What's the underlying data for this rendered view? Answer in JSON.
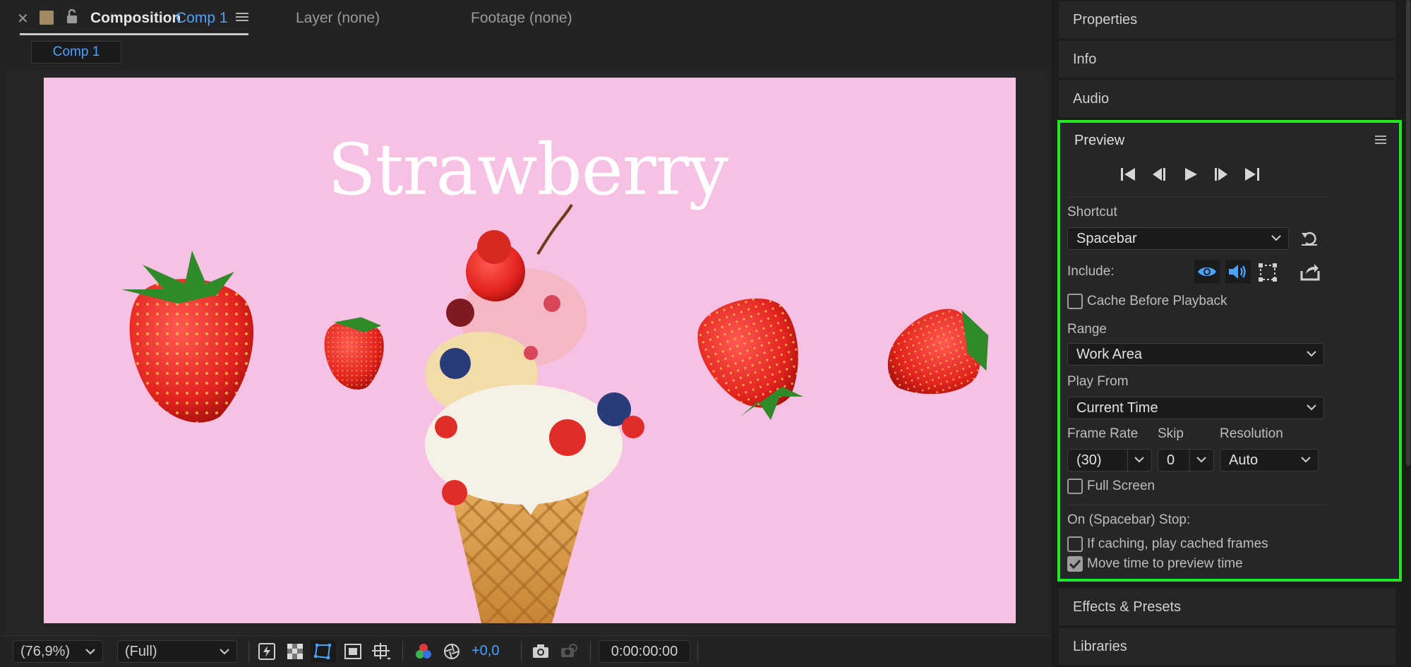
{
  "tabs": {
    "composition_label": "Composition",
    "composition_name": "Comp 1",
    "layer": "Layer (none)",
    "footage": "Footage (none)",
    "subtab": "Comp 1"
  },
  "canvas": {
    "title": "Strawberry",
    "background_color": "#f7c1e4"
  },
  "bottom_bar": {
    "zoom": "(76,9%)",
    "resolution": "(Full)",
    "exposure": "+0,0",
    "timecode": "0:00:00:00"
  },
  "panels": {
    "properties": "Properties",
    "info": "Info",
    "audio": "Audio",
    "effects": "Effects & Presets",
    "libraries": "Libraries"
  },
  "preview": {
    "title": "Preview",
    "shortcut_label": "Shortcut",
    "shortcut_value": "Spacebar",
    "include_label": "Include:",
    "cache_before_playback": "Cache Before Playback",
    "range_label": "Range",
    "range_value": "Work Area",
    "play_from_label": "Play From",
    "play_from_value": "Current Time",
    "frame_rate_label": "Frame Rate",
    "frame_rate_value": "(30)",
    "skip_label": "Skip",
    "skip_value": "0",
    "resolution_label": "Resolution",
    "resolution_value": "Auto",
    "full_screen": "Full Screen",
    "stop_label": "On (Spacebar) Stop:",
    "if_caching": "If caching, play cached frames",
    "move_time": "Move time to preview time",
    "accent_color": "#4aa3ff",
    "highlight_color": "#1ee81e"
  }
}
